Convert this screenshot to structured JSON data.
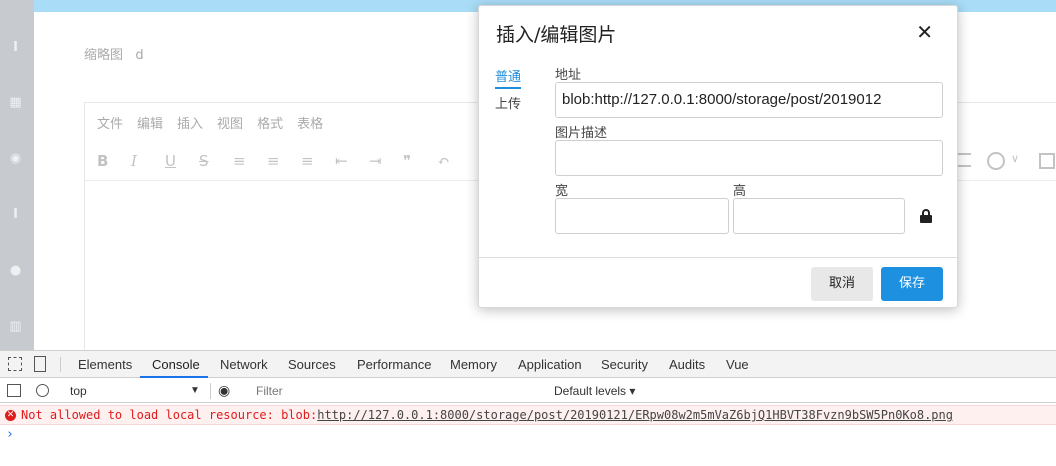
{
  "sidebar": {
    "icons": [
      "text-icon",
      "grid-icon",
      "target-icon",
      "text-icon",
      "speech-icon",
      "book-icon"
    ]
  },
  "page": {
    "thumbnail_label": "缩略图",
    "thumbnail_value": "d"
  },
  "editor": {
    "menus": [
      "文件",
      "编辑",
      "插入",
      "视图",
      "格式",
      "表格"
    ],
    "toolbar_icons": [
      "B",
      "I",
      "U",
      "S",
      "≡",
      "≡",
      "≡",
      "⇤",
      "⇥",
      "❞",
      "↶"
    ]
  },
  "dialog": {
    "title": "插入/编辑图片",
    "close": "✕",
    "tabs": {
      "general": "普通",
      "upload": "上传"
    },
    "fields": {
      "source_label": "地址",
      "source_value": "blob:http://127.0.0.1:8000/storage/post/2019012",
      "description_label": "图片描述",
      "description_value": "",
      "width_label": "宽",
      "width_value": "",
      "height_label": "高",
      "height_value": ""
    },
    "buttons": {
      "cancel": "取消",
      "save": "保存"
    }
  },
  "devtools": {
    "tabs": [
      "Elements",
      "Console",
      "Network",
      "Sources",
      "Performance",
      "Memory",
      "Application",
      "Security",
      "Audits",
      "Vue"
    ],
    "active_tab": "Console",
    "context": "top",
    "filter_placeholder": "Filter",
    "levels": "Default levels ▾",
    "error": {
      "prefix": "Not allowed to load local resource: blob:",
      "url": "http://127.0.0.1:8000/storage/post/20190121/ERpw08w2m5mVaZ6bjQ1HBVT38Fvzn9bSW5Pn0Ko8.png"
    },
    "prompt": "›"
  },
  "colors": {
    "accent": "#1e90e0",
    "topbar": "#a9dcf6",
    "sidebar": "#c7cacf",
    "error": "#e01b1b"
  }
}
